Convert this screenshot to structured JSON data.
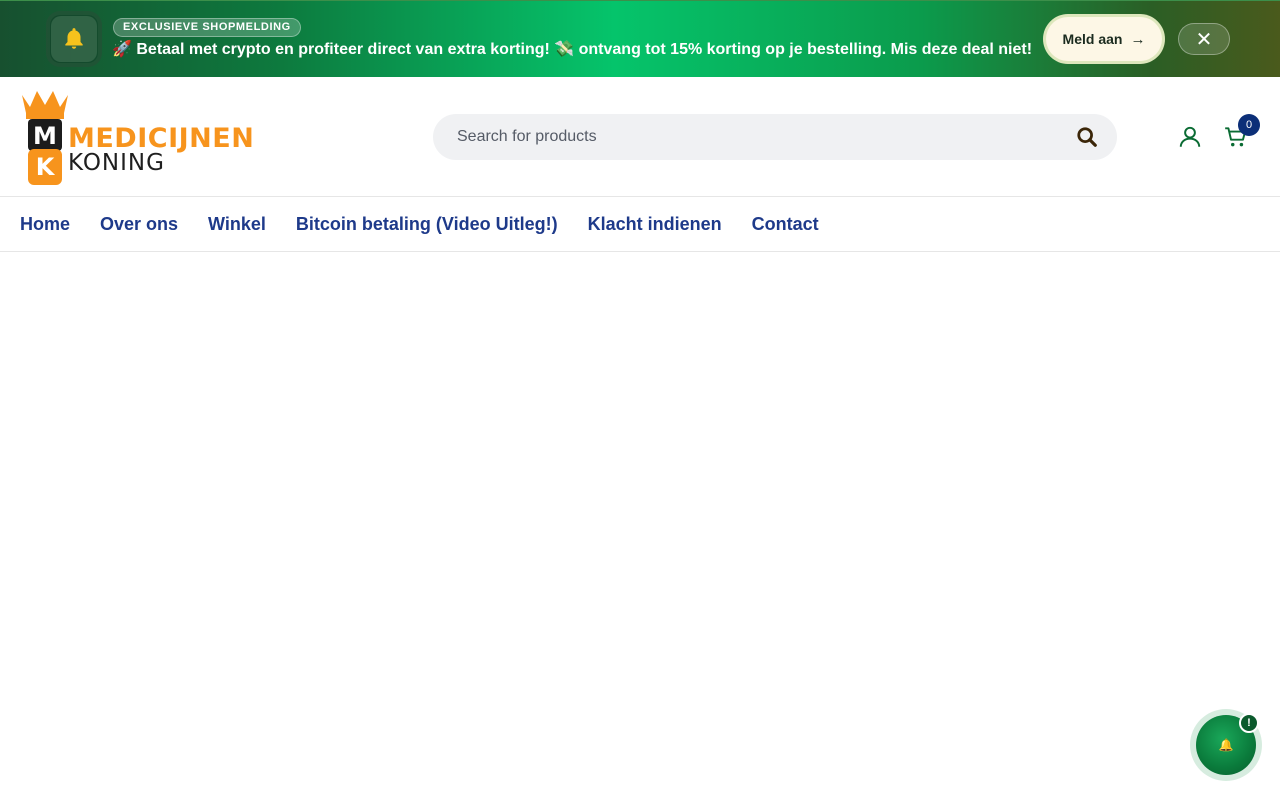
{
  "promo": {
    "tag": "EXCLUSIEVE SHOPMELDING",
    "message": "🚀 Betaal met crypto en profiteer direct van extra korting! 💸 ontvang tot 15% korting op je bestelling. Mis deze deal niet!",
    "cta_label": "Meld aan",
    "cta_arrow": "→",
    "close_label": "✕",
    "bell_icon": "bell-icon"
  },
  "logo": {
    "line1": "MEDICIJNEN",
    "line2": "KONING",
    "mark_top": "M",
    "mark_bottom": "K"
  },
  "search": {
    "placeholder": "Search for products"
  },
  "cart": {
    "count": "0"
  },
  "nav": {
    "items": [
      {
        "label": "Home"
      },
      {
        "label": "Over ons"
      },
      {
        "label": "Winkel"
      },
      {
        "label": "Bitcoin betaling (Video Uitleg!)"
      },
      {
        "label": "Klacht indienen"
      },
      {
        "label": "Contact"
      }
    ]
  },
  "fab": {
    "icon": "🔔",
    "badge": "!"
  },
  "colors": {
    "accent_orange": "#f7941d",
    "nav_blue": "#1e3a8a",
    "brand_green": "#0a7a3b",
    "cart_badge": "#0c2f78"
  }
}
